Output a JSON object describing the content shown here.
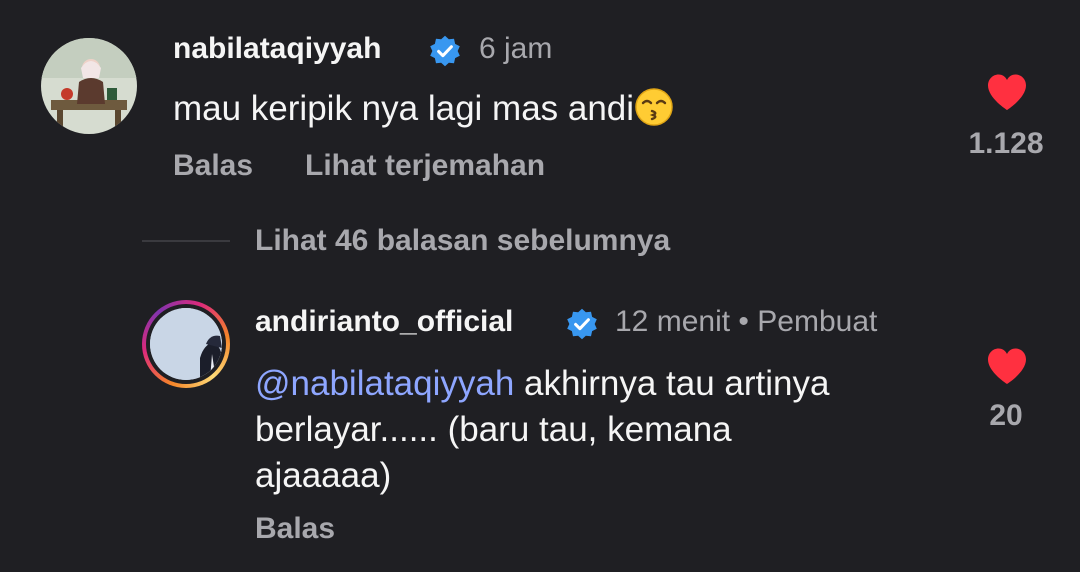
{
  "comment1": {
    "username": "nabilataqiyyah",
    "time": "6 jam",
    "text": "mau keripik nya lagi mas andi",
    "emoji": "kissing-face-emoji",
    "reply_label": "Balas",
    "translate_label": "Lihat terjemahan",
    "like_count": "1.128"
  },
  "view_replies": "Lihat 46 balasan sebelumnya",
  "comment2": {
    "username": "andirianto_official",
    "time": "12 menit",
    "separator": "•",
    "creator_label": "Pembuat",
    "mention": "@nabilataqiyyah",
    "line1": " akhirnya tau artinya",
    "line2": "berlayar...... (baru tau, kemana",
    "line3": "ajaaaaa)",
    "reply_label": "Balas",
    "like_count": "20"
  },
  "colors": {
    "background": "#1f1f23",
    "verified": "#3897f0",
    "heart": "#ff3040",
    "mention": "#8ea6ff",
    "secondary_text": "#a8a8ad"
  }
}
